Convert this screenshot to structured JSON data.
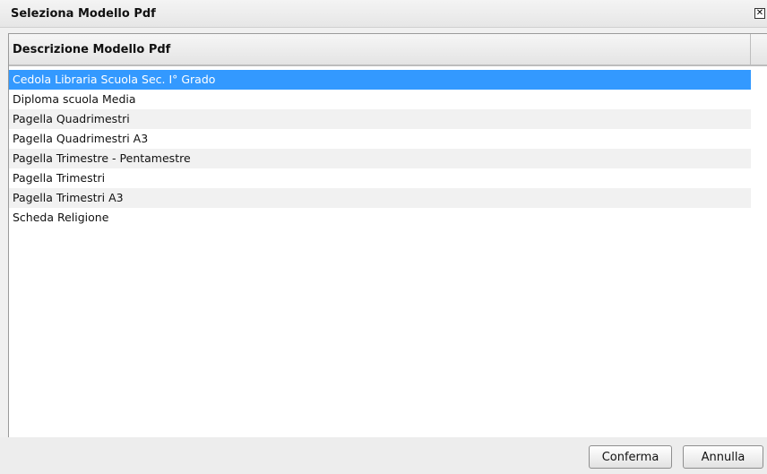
{
  "dialog": {
    "title": "Seleziona Modello Pdf",
    "close_icon": "close-icon",
    "close_glyph": "✕"
  },
  "grid": {
    "column_header": "Descrizione Modello Pdf",
    "rows": [
      "Cedola Libraria Scuola Sec. I° Grado",
      "Diploma scuola Media",
      "Pagella Quadrimestri",
      "Pagella Quadrimestri A3",
      "Pagella Trimestre - Pentamestre",
      "Pagella Trimestri",
      "Pagella Trimestri A3",
      "Scheda Religione"
    ],
    "selected_index": 0
  },
  "buttons": {
    "confirm_label": "Conferma",
    "cancel_label": "Annulla"
  },
  "colors": {
    "selection": "#3399ff",
    "alt_row": "#f1f1f1"
  }
}
